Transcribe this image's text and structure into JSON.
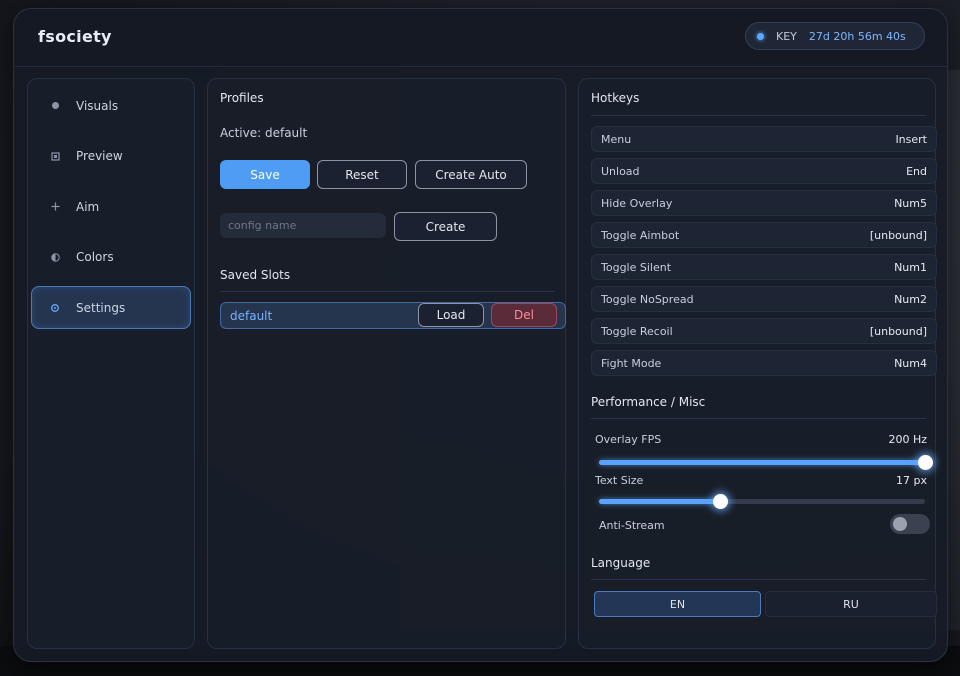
{
  "window": {
    "title": "fsociety",
    "key": {
      "label": "KEY",
      "time": "27d 20h 56m 40s"
    }
  },
  "sidebar": {
    "items": [
      {
        "label": "Visuals",
        "icon": "dot-icon",
        "active": false
      },
      {
        "label": "Preview",
        "icon": "square-icon",
        "active": false
      },
      {
        "label": "Aim",
        "icon": "plus-icon",
        "active": false
      },
      {
        "label": "Colors",
        "icon": "half-circle-icon",
        "active": false
      },
      {
        "label": "Settings",
        "icon": "gear-icon",
        "active": true
      }
    ]
  },
  "profiles": {
    "title": "Profiles",
    "active_text": "Active: default",
    "save_label": "Save",
    "reset_label": "Reset",
    "create_auto_label": "Create Auto",
    "config_placeholder": "config name",
    "create_label": "Create",
    "saved_slots_title": "Saved Slots",
    "slots": [
      {
        "name": "default",
        "load_label": "Load",
        "del_label": "Del"
      }
    ]
  },
  "hotkeys": {
    "title": "Hotkeys",
    "rows": [
      {
        "name": "Menu",
        "key": "Insert"
      },
      {
        "name": "Unload",
        "key": "End"
      },
      {
        "name": "Hide Overlay",
        "key": "Num5"
      },
      {
        "name": "Toggle Aimbot",
        "key": "[unbound]"
      },
      {
        "name": "Toggle Silent",
        "key": "Num1"
      },
      {
        "name": "Toggle NoSpread",
        "key": "Num2"
      },
      {
        "name": "Toggle Recoil",
        "key": "[unbound]"
      },
      {
        "name": "Fight Mode",
        "key": "Num4"
      }
    ]
  },
  "performance": {
    "title": "Performance / Misc",
    "overlay_fps": {
      "label": "Overlay FPS",
      "value": "200 Hz",
      "fraction": 1.0
    },
    "text_size": {
      "label": "Text Size",
      "value": "17 px",
      "fraction": 0.37
    },
    "anti_stream": {
      "label": "Anti-Stream",
      "enabled": false
    }
  },
  "language": {
    "title": "Language",
    "options": [
      "EN",
      "RU"
    ],
    "selected": "EN"
  },
  "colors": {
    "accent": "#4f9cf5",
    "danger": "#ff8a98",
    "panel": "#181e2a"
  }
}
